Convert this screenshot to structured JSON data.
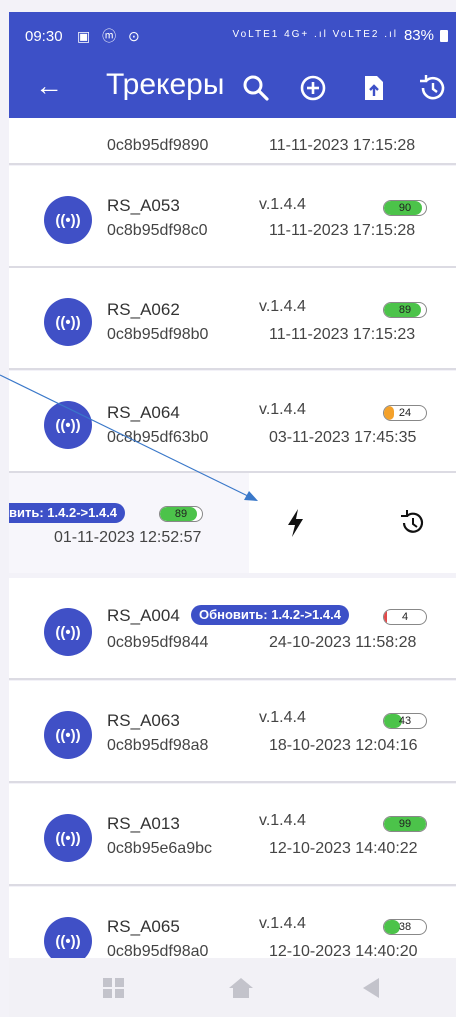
{
  "status_bar": {
    "time": "09:30",
    "icons": "▣ ⓜ ⊙",
    "network": "VoLTE1 4G+ .ıl VoLTE2 .ıl",
    "battery": "83%"
  },
  "app_bar": {
    "title": "Трекеры"
  },
  "trackers": [
    {
      "avatar": "((•))",
      "name": "",
      "id": "0c8b95df9890",
      "version": "",
      "date": "11-11-2023 17:15:28",
      "battery": null
    },
    {
      "avatar": "((•))",
      "name": "RS_A053",
      "id": "0c8b95df98c0",
      "version": "v.1.4.4",
      "date": "11-11-2023 17:15:28",
      "battery": {
        "value": 90,
        "label": "90",
        "color": "#4cc34a"
      }
    },
    {
      "avatar": "((•))",
      "name": "RS_A062",
      "id": "0c8b95df98b0",
      "version": "v.1.4.4",
      "date": "11-11-2023 17:15:23",
      "battery": {
        "value": 89,
        "label": "89",
        "color": "#4cc34a"
      }
    },
    {
      "avatar": "((•))",
      "name": "RS_A064",
      "id": "0c8b95df63b0",
      "version": "v.1.4.4",
      "date": "03-11-2023 17:45:35",
      "battery": {
        "value": 24,
        "label": "24",
        "color": "#f4a12a"
      }
    },
    {
      "avatar": "((•))",
      "name": "RS_A004",
      "id": "0c8b95df9844",
      "version": "",
      "date": "24-10-2023 11:58:28",
      "battery": {
        "value": 4,
        "label": "4",
        "color": "#e24a4a"
      },
      "update_label": "Обновить: 1.4.2->1.4.4"
    },
    {
      "avatar": "((•))",
      "name": "RS_A063",
      "id": "0c8b95df98a8",
      "version": "v.1.4.4",
      "date": "18-10-2023 12:04:16",
      "battery": {
        "value": 43,
        "label": "43",
        "color": "#4cc34a"
      }
    },
    {
      "avatar": "((•))",
      "name": "RS_A013",
      "id": "0c8b95e6a9bc",
      "version": "v.1.4.4",
      "date": "12-10-2023 14:40:22",
      "battery": {
        "value": 99,
        "label": "99",
        "color": "#4cc34a"
      }
    },
    {
      "avatar": "((•))",
      "name": "RS_A065",
      "id": "0c8b95df98a0",
      "version": "v.1.4.4",
      "date": "12-10-2023 14:40:20",
      "battery": {
        "value": 38,
        "label": "38",
        "color": "#4cc34a"
      }
    }
  ],
  "swiped_row": {
    "update_label": "вить: 1.4.2->1.4.4",
    "battery": {
      "value": 89,
      "label": "89",
      "color": "#4cc34a"
    },
    "date": "01-11-2023 12:52:57",
    "actions": [
      "lightning-icon",
      "history-icon"
    ]
  },
  "icons": {
    "app_bar": [
      "back-arrow-icon",
      "search-icon",
      "add-circle-icon",
      "upload-file-icon",
      "history-icon"
    ],
    "nav_bar": [
      "recents-icon",
      "home-icon",
      "back-triangle-icon"
    ]
  },
  "colors": {
    "primary": "#3d50c7",
    "avatar": "#4050c6",
    "battery_good": "#4cc34a",
    "battery_mid": "#f4a12a",
    "annotation_line": "#3a78c9"
  }
}
